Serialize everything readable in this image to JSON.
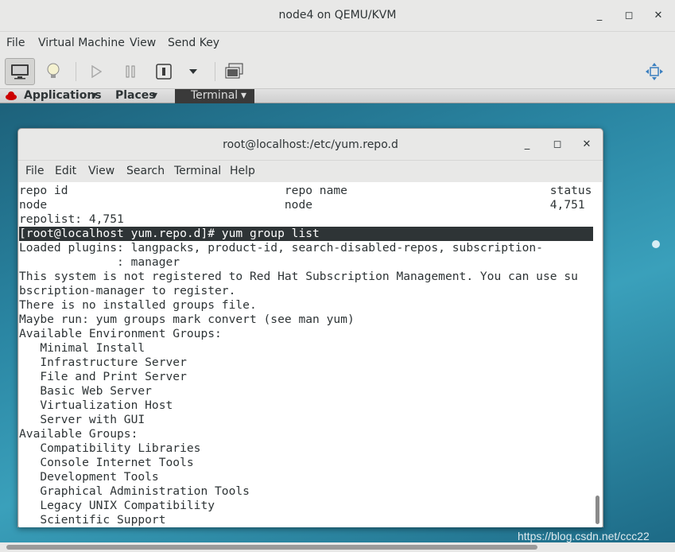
{
  "window": {
    "title": "node4 on QEMU/KVM",
    "controls": [
      "_",
      "◻",
      "✕"
    ]
  },
  "menubar": [
    "File",
    "Virtual Machine",
    "View",
    "Send Key"
  ],
  "toolbar": {
    "icons": [
      "monitor-icon",
      "lightbulb-icon",
      "play-icon",
      "pause-icon",
      "power-icon",
      "dropdown-icon",
      "snapshot-icon",
      "fullscreen-icon"
    ]
  },
  "guest_panel": {
    "applications": "Applications",
    "places": "Places",
    "terminal_task": "Terminal"
  },
  "terminal": {
    "title": "root@localhost:/etc/yum.repo.d",
    "menu": [
      "File",
      "Edit",
      "View",
      "Search",
      "Terminal",
      "Help"
    ],
    "lines": [
      "repo id                               repo name                             status",
      "node                                  node                                  4,751",
      "repolist: 4,751",
      "[root@localhost yum.repo.d]# yum group list",
      "Loaded plugins: langpacks, product-id, search-disabled-repos, subscription-",
      "              : manager",
      "This system is not registered to Red Hat Subscription Management. You can use su",
      "bscription-manager to register.",
      "There is no installed groups file.",
      "Maybe run: yum groups mark convert (see man yum)",
      "Available Environment Groups:",
      "   Minimal Install",
      "   Infrastructure Server",
      "   File and Print Server",
      "   Basic Web Server",
      "   Virtualization Host",
      "   Server with GUI",
      "Available Groups:",
      "   Compatibility Libraries",
      "   Console Internet Tools",
      "   Development Tools",
      "   Graphical Administration Tools",
      "   Legacy UNIX Compatibility",
      "   Scientific Support"
    ],
    "highlight_line": 3
  },
  "watermark": "https://blog.csdn.net/ccc22"
}
